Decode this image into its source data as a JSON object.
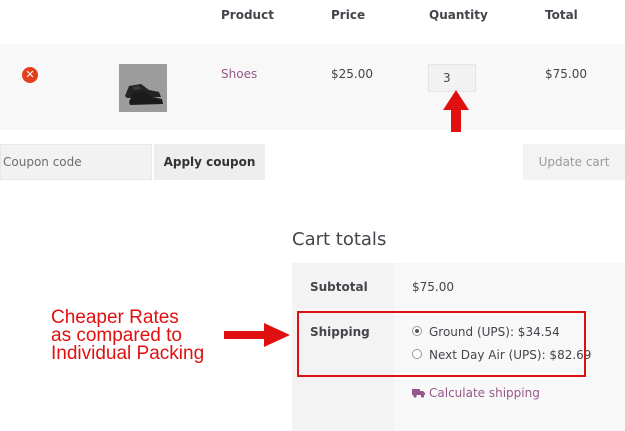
{
  "cart": {
    "headers": {
      "product": "Product",
      "price": "Price",
      "quantity": "Quantity",
      "total": "Total"
    },
    "remove_symbol": "✕",
    "item": {
      "name": "Shoes",
      "price": "$25.00",
      "quantity": "3",
      "total": "$75.00"
    }
  },
  "coupon": {
    "placeholder": "Coupon code",
    "apply_label": "Apply coupon"
  },
  "update_label": "Update cart",
  "totals": {
    "title": "Cart totals",
    "subtotal_label": "Subtotal",
    "subtotal_value": "$75.00",
    "shipping_label": "Shipping",
    "shipping_options": [
      {
        "label": "Ground (UPS): $34.54",
        "selected": true
      },
      {
        "label": "Next Day Air (UPS): $82.69",
        "selected": false
      }
    ],
    "calc_label": "Calculate shipping"
  },
  "annotation": {
    "lines": [
      "Cheaper Rates",
      "as compared to",
      "Individual Packing"
    ],
    "color": "#e01010"
  },
  "colors": {
    "accent": "#96588a",
    "remove": "#e2401c"
  }
}
